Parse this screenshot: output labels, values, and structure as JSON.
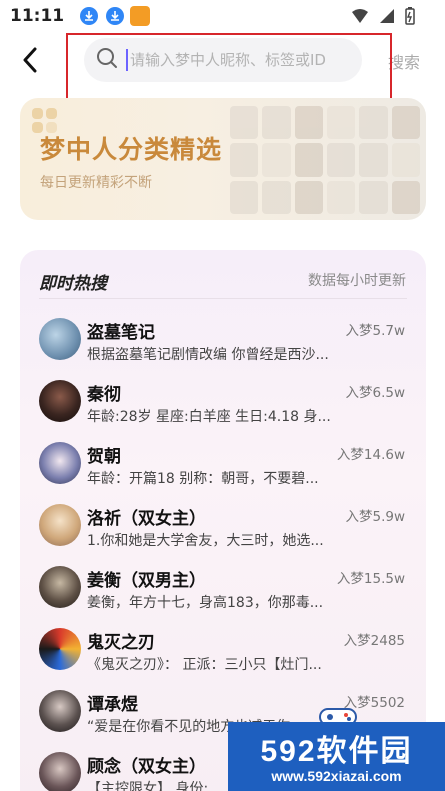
{
  "status_bar": {
    "time": "11:11",
    "notification_icons": [
      "download-icon",
      "download-icon",
      "app-icon"
    ],
    "system_icons": [
      "wifi-icon",
      "signal-icon",
      "battery-icon"
    ]
  },
  "header": {
    "back_icon": "chevron-left-icon",
    "search_placeholder": "请输入梦中人昵称、标签或ID",
    "search_label": "搜索"
  },
  "banner": {
    "title": "梦中人分类精选",
    "subtitle": "每日更新精彩不断"
  },
  "hot": {
    "title": "即时热搜",
    "update_note": "数据每小时更新",
    "items": [
      {
        "name": "盗墓笔记",
        "desc": "根据盗墓笔记剧情改编 你曾经是西沙...",
        "count": "入梦5.7w"
      },
      {
        "name": "秦彻",
        "desc": "年龄:28岁 星座:白羊座 生日:4.18 身...",
        "count": "入梦6.5w"
      },
      {
        "name": "贺朝",
        "desc": "年龄：开篇18 别称：朝哥，不要碧...",
        "count": "入梦14.6w"
      },
      {
        "name": "洛祈（双女主）",
        "desc": "1.你和她是大学舍友，大三时，她选...",
        "count": "入梦5.9w"
      },
      {
        "name": "姜衡（双男主）",
        "desc": "姜衡，年方十七，身高183，你那毒...",
        "count": "入梦15.5w"
      },
      {
        "name": "鬼灭之刃",
        "desc": "《鬼灭之刃》： 正派：三小只【灶门...",
        "count": "入梦2485"
      },
      {
        "name": "谭承煜",
        "desc": "“爱是在你看不见的地方也减于你...",
        "count": "入梦5502"
      },
      {
        "name": "顾念（双女主）",
        "desc": "【主控限女】 身份:",
        "count": ""
      }
    ]
  },
  "watermark": {
    "brand": "592软件园",
    "url": "www.592xiazai.com"
  },
  "colors": {
    "accent": "#6c63ff",
    "banner_title": "#c9893b",
    "frame": "#d7262b",
    "watermark_bg": "#1e5fbf"
  }
}
